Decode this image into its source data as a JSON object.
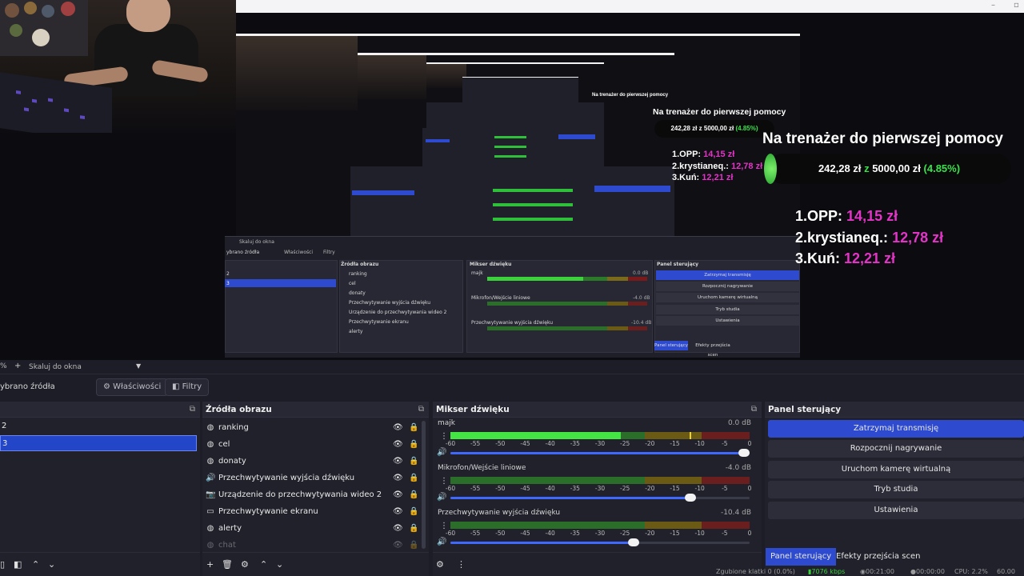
{
  "donation_goal": {
    "title": "Na trenażer do pierwszej pomocy",
    "raised": "242,28 zł",
    "of": "z",
    "goal": "5000,00 zł",
    "percent": "(4.85%)",
    "ranking": [
      {
        "label": "1.OPP:",
        "amount": "14,15 zł"
      },
      {
        "label": "2.krystianeq.:",
        "amount": "12,78 zł"
      },
      {
        "label": "3.Kuń:",
        "amount": "12,21 zł"
      }
    ],
    "colors": {
      "amount": "#e434c8",
      "progress": "#39e24b"
    }
  },
  "nested_capture": {
    "scale_label": "Skaluj do okna",
    "sources_title": "Źródła obrazu",
    "selected_source_label": "ybrano źródła",
    "properties": "Właściwości",
    "filters": "Filtry",
    "mixer_title": "Mikser dźwięku",
    "controls_title": "Panel sterujący",
    "scenes": [
      "2",
      "3"
    ],
    "sources": [
      "ranking",
      "cel",
      "donaty",
      "Przechwytywanie wyjścia dźwięku",
      "Urządzenie do przechwytywania wideo 2",
      "Przechwytywanie ekranu",
      "alerty",
      "chat"
    ],
    "channels": [
      "majk",
      "Mikrofon/Wejście liniowe",
      "Przechwytywanie wyjścia dźwięku"
    ],
    "dbs": [
      "0.0 dB",
      "-4.0 dB",
      "-10.4 dB"
    ],
    "buttons": [
      "Zatrzymaj transmisję",
      "Rozpocznij nagrywanie",
      "Uruchom kamerę wirtualną",
      "Tryb studia",
      "Ustawienia"
    ],
    "tabs": [
      "Panel sterujący",
      "Efekty przejścia scen"
    ]
  },
  "toolbar": {
    "zoom": "%",
    "add": "+",
    "scale_label": "Skaluj do okna",
    "selected_source": "ybrano źródła",
    "properties_label": "Właściwości",
    "filters_label": "Filtry"
  },
  "scenes_dock": {
    "items": [
      {
        "label": "2",
        "selected": false
      },
      {
        "label": "3",
        "selected": true
      }
    ]
  },
  "sources_dock": {
    "title": "Źródła obrazu",
    "items": [
      {
        "label": "ranking",
        "icon": "globe-icon"
      },
      {
        "label": "cel",
        "icon": "globe-icon"
      },
      {
        "label": "donaty",
        "icon": "globe-icon"
      },
      {
        "label": "Przechwytywanie wyjścia dźwięku",
        "icon": "speaker-icon"
      },
      {
        "label": "Urządzenie do przechwytywania wideo 2",
        "icon": "camera-icon"
      },
      {
        "label": "Przechwytywanie ekranu",
        "icon": "monitor-icon"
      },
      {
        "label": "alerty",
        "icon": "globe-icon"
      },
      {
        "label": "chat",
        "icon": "globe-icon"
      }
    ]
  },
  "mixer": {
    "title": "Mikser dźwięku",
    "ticks": [
      "-60",
      "-55",
      "-50",
      "-45",
      "-40",
      "-35",
      "-30",
      "-25",
      "-20",
      "-15",
      "-10",
      "-5",
      "0"
    ],
    "channels": [
      {
        "name": "majk",
        "db": "0.0 dB",
        "level": 0.57,
        "peak": 0.8,
        "volume": 1.0
      },
      {
        "name": "Mikrofon/Wejście liniowe",
        "db": "-4.0 dB",
        "level": 0.0,
        "peak": 0,
        "volume": 0.82
      },
      {
        "name": "Przechwytywanie wyjścia dźwięku",
        "db": "-10.4 dB",
        "level": 0.0,
        "peak": 0,
        "volume": 0.63
      }
    ]
  },
  "controls": {
    "title": "Panel sterujący",
    "buttons": [
      "Zatrzymaj transmisję",
      "Rozpocznij nagrywanie",
      "Uruchom kamerę wirtualną",
      "Tryb studia",
      "Ustawienia"
    ],
    "tabs": [
      "Panel sterujący",
      "Efekty przejścia scen"
    ]
  },
  "status": {
    "dropped": "Zgubione klatki 0 (0.0%)",
    "bitrate": "7076 kbps",
    "live": "00:21:00",
    "rec": "00:00:00",
    "cpu": "CPU: 2.2%",
    "fps": "60.00"
  }
}
